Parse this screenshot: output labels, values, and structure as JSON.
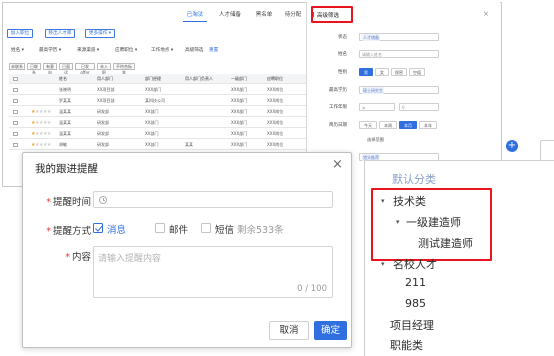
{
  "tabs": [
    "已淘汰",
    "人才储备",
    "黑名单",
    "待分配"
  ],
  "actions": [
    "加入职位",
    "移出人才库",
    "更多操作 ▾"
  ],
  "filters": [
    "姓名 ▾",
    "最高学历 ▾",
    "来源渠道 ▾",
    "应聘职位 ▾",
    "工作地点 ▾",
    "高级筛选",
    "重置"
  ],
  "chips": [
    "未联系",
    "已联系",
    "有意向",
    "已面试",
    "已发offer",
    "未入职",
    "不符合标准"
  ],
  "grid": {
    "headers": [
      "姓名",
      "用人部门",
      "部门经理",
      "用人部门负责人",
      "一级部门",
      "应聘职位"
    ],
    "rows": [
      [
        "张晓明",
        "XX项目部",
        "XXX部门",
        "",
        "XXX部门",
        "XXX岗位"
      ],
      [
        "罗某某",
        "XX项目部",
        "某科技公司",
        "",
        "XXX部门",
        "XXX岗位"
      ],
      [
        "温某某",
        "研发部",
        "XX部门",
        "",
        "XXX部门",
        "XXX岗位"
      ],
      [
        "温某某",
        "研发部",
        "XX部门",
        "",
        "XXX部门",
        "XXX岗位"
      ],
      [
        "温某某",
        "研发部",
        "XX部门",
        "",
        "XXX部门",
        "XXX岗位"
      ],
      [
        "胡敏",
        "研发部",
        "XX部门",
        "某某",
        "XXX部门",
        "XXX岗位"
      ]
    ],
    "ratings": [
      0,
      0,
      1,
      1,
      1,
      1
    ]
  },
  "filter_panel": {
    "title": "高级筛选",
    "close": "×",
    "labels": [
      "状态",
      "姓名",
      "性别",
      "最高学历",
      "工作年限",
      "简历日期",
      "",
      "简历来源"
    ],
    "status_value": "人才储备",
    "name_placeholder": "请输入姓名",
    "gender_options": [
      "男",
      "女",
      "保密",
      "空值"
    ],
    "edu_value": "硕士研究生",
    "years": [
      "≥",
      "0"
    ],
    "date_options": [
      "今天",
      "本周",
      "本月",
      "本年"
    ],
    "date_sub": "选择范围",
    "source_value": "猎头推荐"
  },
  "tree": {
    "root": "默认分类",
    "nodes": [
      {
        "label": "技术类",
        "caret": "▾"
      },
      {
        "label": "一级建造师",
        "caret": "▾"
      },
      {
        "label": "测试建造师",
        "caret": ""
      },
      {
        "label": "名校人才",
        "caret": "▾"
      },
      {
        "label": "211",
        "caret": ""
      },
      {
        "label": "985",
        "caret": ""
      },
      {
        "label": "项目经理",
        "caret": ""
      },
      {
        "label": "职能类",
        "caret": ""
      }
    ]
  },
  "dialog": {
    "title": "我的跟进提醒",
    "close": "×",
    "time_label": "提醒时间",
    "method_label": "提醒方式",
    "content_label": "内容",
    "required_mark": "*",
    "methods": [
      {
        "label": "消息",
        "checked": true
      },
      {
        "label": "邮件",
        "checked": false
      },
      {
        "label": "短信",
        "checked": false
      }
    ],
    "sms_remaining": "剩余533条",
    "content_placeholder": "请输入提醒内容",
    "counter": "0 / 100",
    "cancel_label": "取消",
    "ok_label": "确定"
  },
  "add_button": "+",
  "colors": {
    "accent": "#2f6fe0",
    "highlight": "#e8141f",
    "star": "#f5a623"
  }
}
